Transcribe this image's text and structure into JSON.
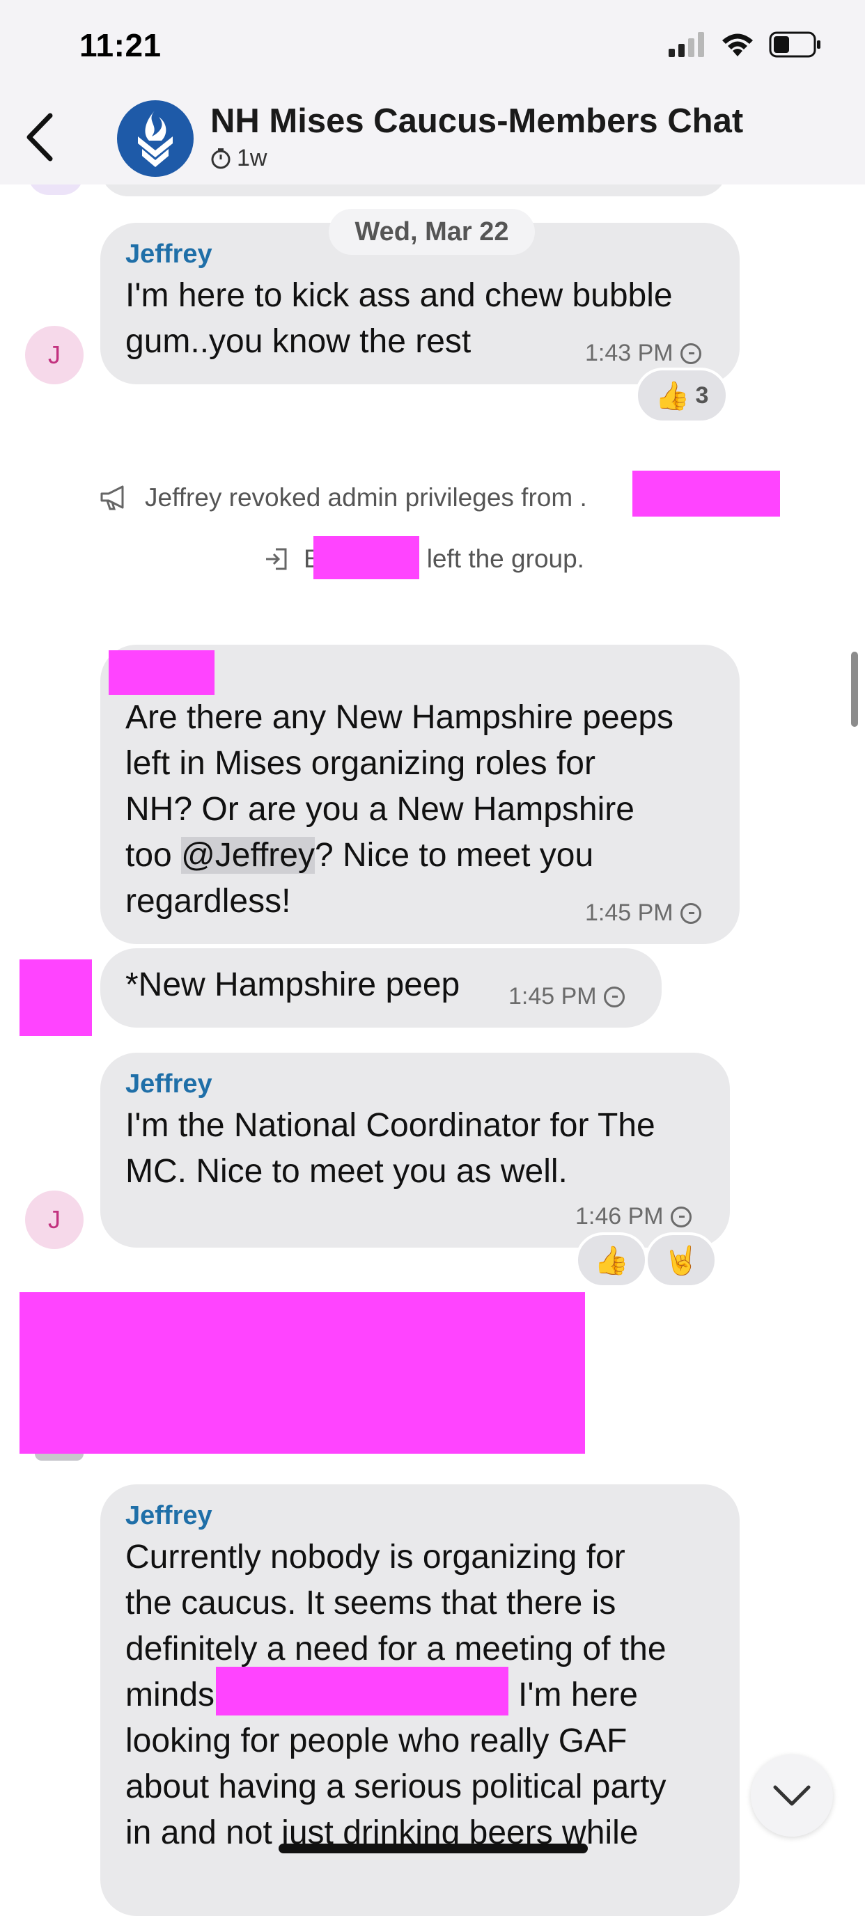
{
  "status_bar": {
    "time": "11:21"
  },
  "header": {
    "title": "NH Mises Caucus-Members Chat",
    "subtitle": "1w"
  },
  "date_chip": "Wed, Mar 22",
  "messages": [
    {
      "sender": "Jeffrey",
      "avatar": "J",
      "lines": [
        "I'm here to kick ass and chew bubble",
        "gum..you know the rest"
      ],
      "time": "1:43 PM",
      "reaction": {
        "emoji": "👍",
        "count": "3"
      }
    },
    {
      "lines": [
        "Are there any New Hampshire peeps",
        "left in Mises organizing roles  for",
        "NH? Or are you a New Hampshire"
      ],
      "line4_pre": "too ",
      "line4_mention": "@Jeffrey",
      "line4_post": "? Nice to meet you",
      "line5": "regardless!",
      "time": "1:45 PM"
    },
    {
      "lines": [
        "*New Hampshire peep"
      ],
      "time": "1:45 PM"
    },
    {
      "sender": "Jeffrey",
      "avatar": "J",
      "lines": [
        "I'm the National Coordinator for The",
        "MC. Nice to meet you as well."
      ],
      "time": "1:46 PM",
      "reactions": [
        "👍",
        "🤘"
      ]
    },
    {
      "sender": "Jeffrey",
      "lines": [
        "Currently nobody is organizing for",
        "the caucus. It seems that there is",
        "definitely a need for a meeting of the"
      ],
      "line4_pre": "minds",
      "line4_post": "I'm here",
      "lines_after": [
        "looking for people who really GAF",
        "about having a serious political party",
        "in and not just drinking beers while"
      ]
    }
  ],
  "system_events": [
    {
      "icon": "megaphone-icon",
      "text": "Jeffrey revoked admin privileges from ."
    },
    {
      "icon": "leave-icon",
      "text_pre": "E",
      "text": "left the group."
    }
  ],
  "colors": {
    "accent": "#1f6fa8",
    "bubble": "#e9e9eb",
    "redaction": "#ff44ff",
    "avatar_bg": "#f6d9ea",
    "avatar_fg": "#c2327f"
  }
}
